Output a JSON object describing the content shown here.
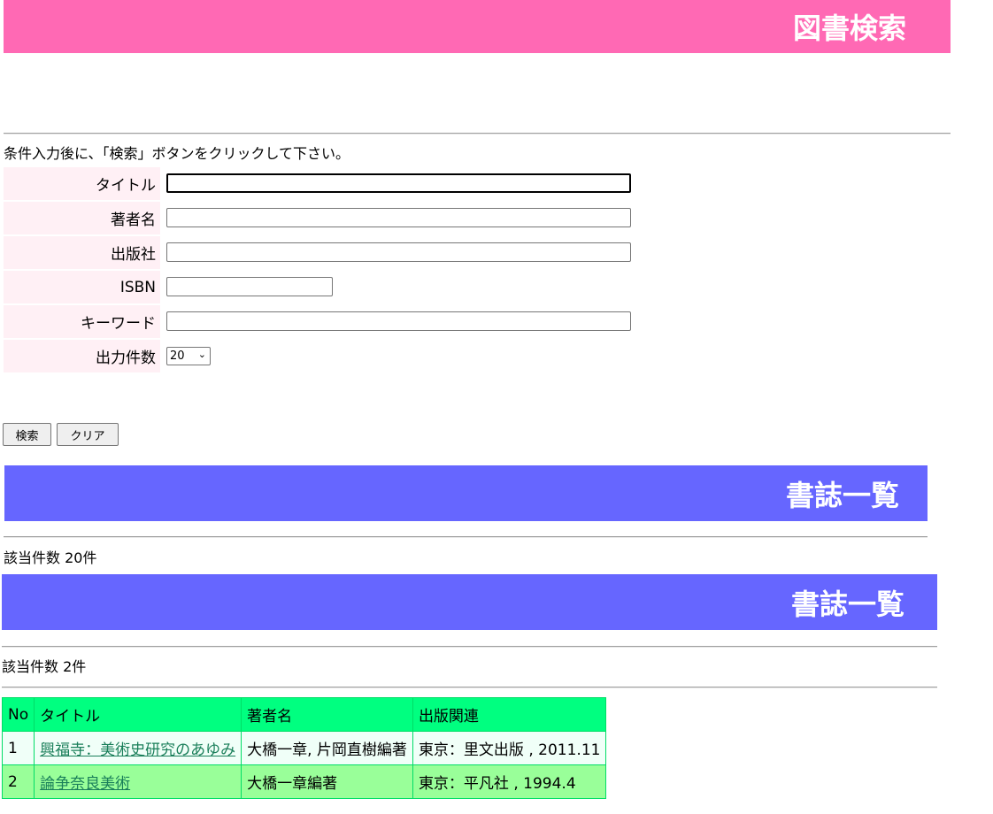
{
  "header": {
    "title": "図書検索"
  },
  "search": {
    "instruction": "条件入力後に、「検索」ボタンをクリックして下さい。",
    "fields": {
      "title": {
        "label": "タイトル",
        "value": ""
      },
      "author": {
        "label": "著者名",
        "value": ""
      },
      "publisher": {
        "label": "出版社",
        "value": ""
      },
      "isbn": {
        "label": "ISBN",
        "value": ""
      },
      "keyword": {
        "label": "キーワード",
        "value": ""
      },
      "count": {
        "label": "出力件数",
        "value": "20"
      }
    },
    "buttons": {
      "search": "検索",
      "clear": "クリア"
    }
  },
  "results1": {
    "title": "書誌一覧",
    "count_text": "該当件数 20件"
  },
  "results2": {
    "title": "書誌一覧",
    "count_text": "該当件数 2件",
    "table": {
      "headers": [
        "No",
        "タイトル",
        "著者名",
        "出版関連"
      ],
      "rows": [
        [
          "1",
          "興福寺：美術史研究のあゆみ",
          "大橋一章, 片岡直樹編著",
          "東京：里文出版 , 2011.11"
        ],
        [
          "2",
          "論争奈良美術",
          "大橋一章編著",
          "東京：平凡社 , 1994.4"
        ]
      ]
    }
  },
  "colors": {
    "header_bg": "#ff69b4",
    "section_bg": "#6666ff",
    "label_bg": "#fff0f5",
    "table_header_bg": "#00ff80",
    "row_odd_bg": "#f0fff8",
    "row_even_bg": "#99ff99"
  }
}
